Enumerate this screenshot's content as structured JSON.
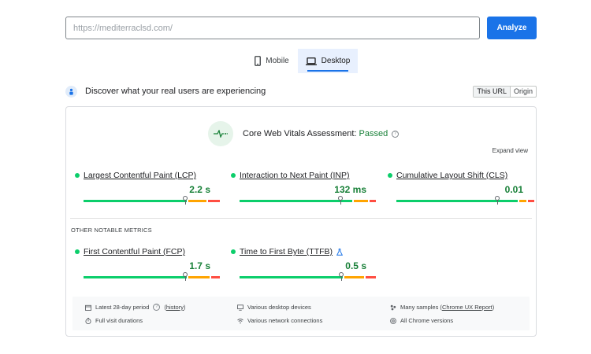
{
  "search": {
    "url": "https://mediterraclsd.com/",
    "analyze_label": "Analyze"
  },
  "device_tabs": {
    "mobile": "Mobile",
    "desktop": "Desktop",
    "active": "desktop"
  },
  "discover": {
    "title": "Discover what your real users are experiencing",
    "this_url": "This URL",
    "origin": "Origin"
  },
  "assessment": {
    "label": "Core Web Vitals Assessment:",
    "status": "Passed",
    "expand": "Expand view"
  },
  "core_metrics": [
    {
      "name": "Largest Contentful Paint (LCP)",
      "value": "2.2 s"
    },
    {
      "name": "Interaction to Next Paint (INP)",
      "value": "132 ms"
    },
    {
      "name": "Cumulative Layout Shift (CLS)",
      "value": "0.01"
    }
  ],
  "other_metrics_title": "OTHER NOTABLE METRICS",
  "other_metrics": [
    {
      "name": "First Contentful Paint (FCP)",
      "value": "1.7 s"
    },
    {
      "name": "Time to First Byte (TTFB)",
      "value": "0.5 s"
    }
  ],
  "footer": {
    "period": "Latest 28-day period",
    "history": "history",
    "devices": "Various desktop devices",
    "samples_prefix": "Many samples (",
    "crux_link": "Chrome UX Report",
    "samples_suffix": ")",
    "durations": "Full visit durations",
    "network": "Various network connections",
    "versions": "All Chrome versions"
  },
  "colors": {
    "accent": "#1a73e8",
    "good": "#0cce6b",
    "needs_improvement": "#ffa400",
    "poor": "#ff4e42",
    "passed_text": "#188038"
  }
}
